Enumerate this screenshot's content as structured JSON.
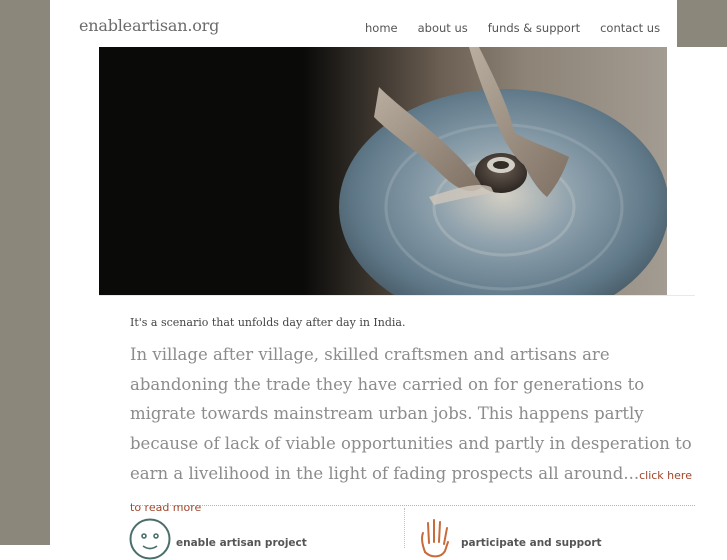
{
  "site": {
    "logo": "enableartisan.org"
  },
  "nav": {
    "items": [
      "home",
      "about us",
      "funds & support",
      "contact us"
    ]
  },
  "content": {
    "intro": "It's a scenario that unfolds day after day in India.",
    "lead": "In village after village, skilled craftsmen and artisans are abandoning the trade they have carried on for generations to migrate towards mainstream urban jobs. This happens partly because of lack of viable opportunities and partly in desperation to earn a livelihood in the light of fading prospects all around...",
    "read_more": "click here to read more"
  },
  "cards": [
    {
      "title": "enable artisan project",
      "icon": "smiley-icon"
    },
    {
      "title": "participate and support",
      "icon": "hand-icon"
    }
  ],
  "hero": {
    "subject": "potter's hands shaping a clay pot on a turning wheel"
  },
  "colors": {
    "gutter": "#8b887b",
    "link": "#a0452a",
    "text_muted": "#8c8c8c"
  }
}
